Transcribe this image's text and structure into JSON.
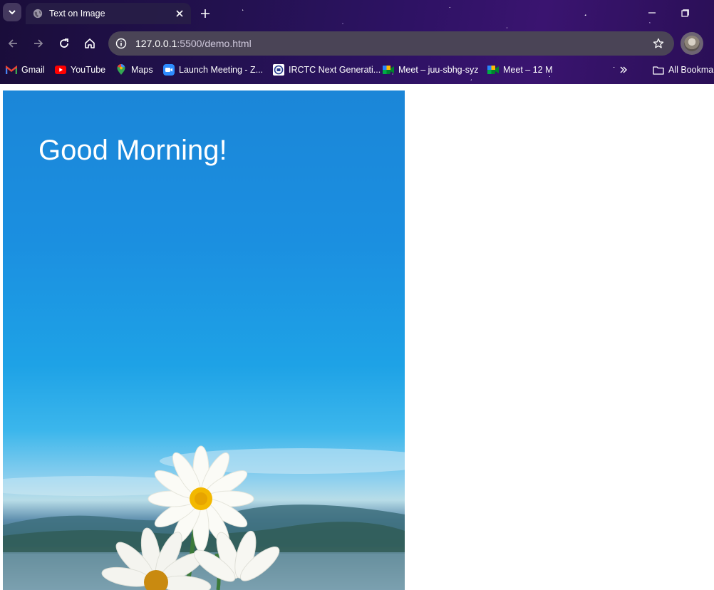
{
  "browser": {
    "tab": {
      "title": "Text on Image"
    },
    "address_bar": {
      "host": "127.0.0.1",
      "path": ":5500/demo.html"
    },
    "bookmarks": [
      {
        "label": "Gmail",
        "icon": "gmail-icon"
      },
      {
        "label": "YouTube",
        "icon": "youtube-icon"
      },
      {
        "label": "Maps",
        "icon": "maps-icon"
      },
      {
        "label": "Launch Meeting - Z...",
        "icon": "zoom-icon"
      },
      {
        "label": "IRCTC Next Generati...",
        "icon": "irctc-icon"
      },
      {
        "label": "Meet – juu-sbhg-syz",
        "icon": "meet-icon"
      },
      {
        "label": "Meet – 12 M",
        "icon": "meet-icon"
      }
    ],
    "all_bookmarks_label": "All Bookmar",
    "colors": {
      "omnibox_bg": "#4a4456",
      "theme": "#2d1263"
    }
  },
  "page": {
    "heading": "Good Morning!",
    "background_image": "blue sky with white daisies and lake"
  }
}
